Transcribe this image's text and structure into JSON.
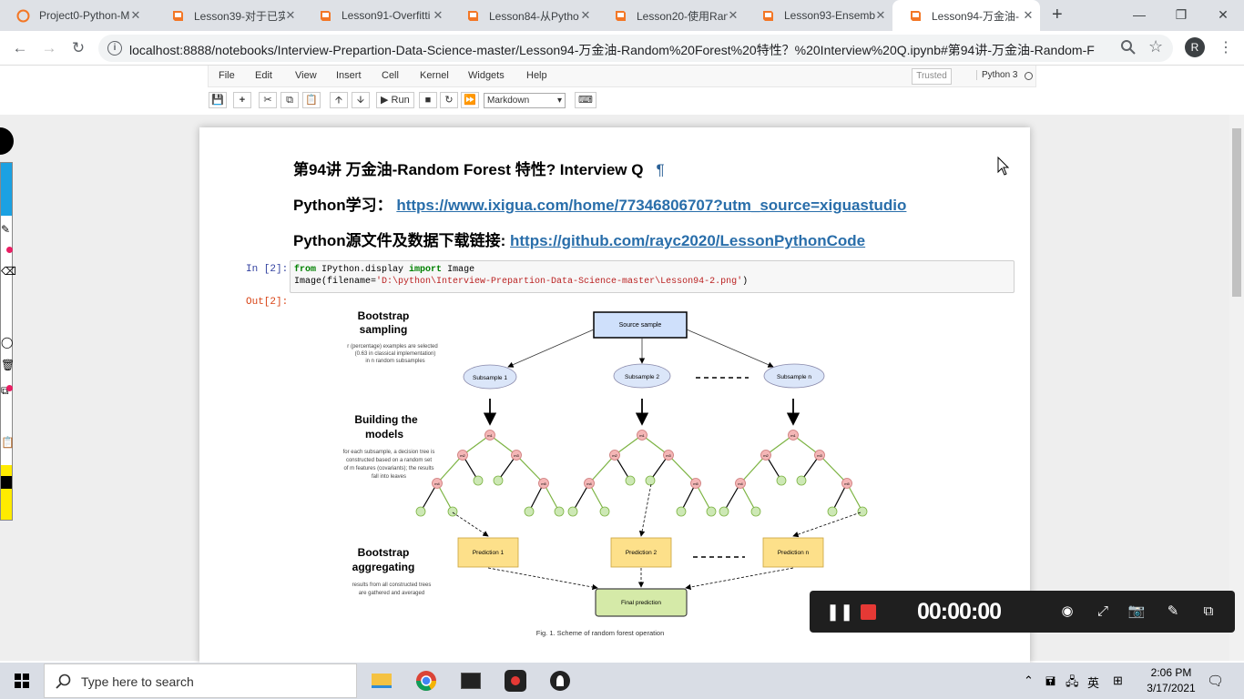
{
  "browser": {
    "tabs": [
      {
        "title": "Project0-Python-M",
        "icon": "jupyter-logo-icon",
        "active": false
      },
      {
        "title": "Lesson39-对于已实",
        "icon": "notebook-book-icon",
        "active": false
      },
      {
        "title": "Lesson91-Overfitti",
        "icon": "notebook-book-icon",
        "active": false
      },
      {
        "title": "Lesson84-从Pytho",
        "icon": "notebook-book-icon",
        "active": false
      },
      {
        "title": "Lesson20-使用Ran",
        "icon": "notebook-book-icon",
        "active": false
      },
      {
        "title": "Lesson93-Ensemb",
        "icon": "notebook-book-icon",
        "active": false
      },
      {
        "title": "Lesson94-万金油-",
        "icon": "notebook-book-icon",
        "active": true
      }
    ],
    "new_tab": "+",
    "url": "localhost:8888/notebooks/Interview-Prepartion-Data-Science-master/Lesson94-万金油-Random%20Forest%20特性？%20Interview%20Q.ipynb#第94讲-万金油-Random-For...",
    "profile_initial": "R"
  },
  "jupyter": {
    "menu": [
      "File",
      "Edit",
      "View",
      "Insert",
      "Cell",
      "Kernel",
      "Widgets",
      "Help"
    ],
    "trusted": "Trusted",
    "kernel": "Python 3",
    "run_label": "Run",
    "cell_type": "Markdown"
  },
  "notebook": {
    "heading": "第94讲 万金油-Random Forest 特性? Interview Q",
    "pilcrow": "¶",
    "line1_label": "Python学习：",
    "line1_link": "https://www.ixigua.com/home/77346806707?utm_source=xiguastudio",
    "line2_label": "Python源文件及数据下载链接:",
    "line2_link": "https://github.com/rayc2020/LessonPythonCode",
    "in_prompt": "In [2]:",
    "out_prompt": "Out[2]:",
    "code_line1_a": "from",
    "code_line1_b": " IPython.display ",
    "code_line1_c": "import",
    "code_line1_d": " Image",
    "code_line2_a": "Image(filename=",
    "code_line2_b": "'D:\\python\\Interview-Prepartion-Data-Science-master\\Lesson94-2.png'",
    "code_line2_c": ")"
  },
  "diagram": {
    "source": "Source sample",
    "subsamples": [
      "Subsample 1",
      "Subsample 2",
      "Subsample n"
    ],
    "dashes": "- - - - - -",
    "section1_title": "Bootstrap sampling",
    "section1_desc": "r (percentage) examples are selected (0.63 in classical implementation) in n random subsamples",
    "section2_title": "Building the models",
    "section2_desc": "for each subsample, a decision tree is constructed based on a random set of m features (covariants); the results fall into leaves",
    "section3_title": "Bootstrap aggregating",
    "section3_desc": "results from all constructed trees are gathered and averaged",
    "predictions": [
      "Prediction 1",
      "Prediction 2",
      "Prediction n"
    ],
    "final": "Final prediction",
    "caption": "Fig. 1. Scheme of random forest operation",
    "node_labels": [
      "m1",
      "m2",
      "m3",
      "m4",
      "m5"
    ]
  },
  "recorder": {
    "timer": "00:00:00"
  },
  "taskbar": {
    "search_placeholder": "Type here to search",
    "ime": "英",
    "time": "2:06 PM",
    "date": "3/17/2021"
  }
}
